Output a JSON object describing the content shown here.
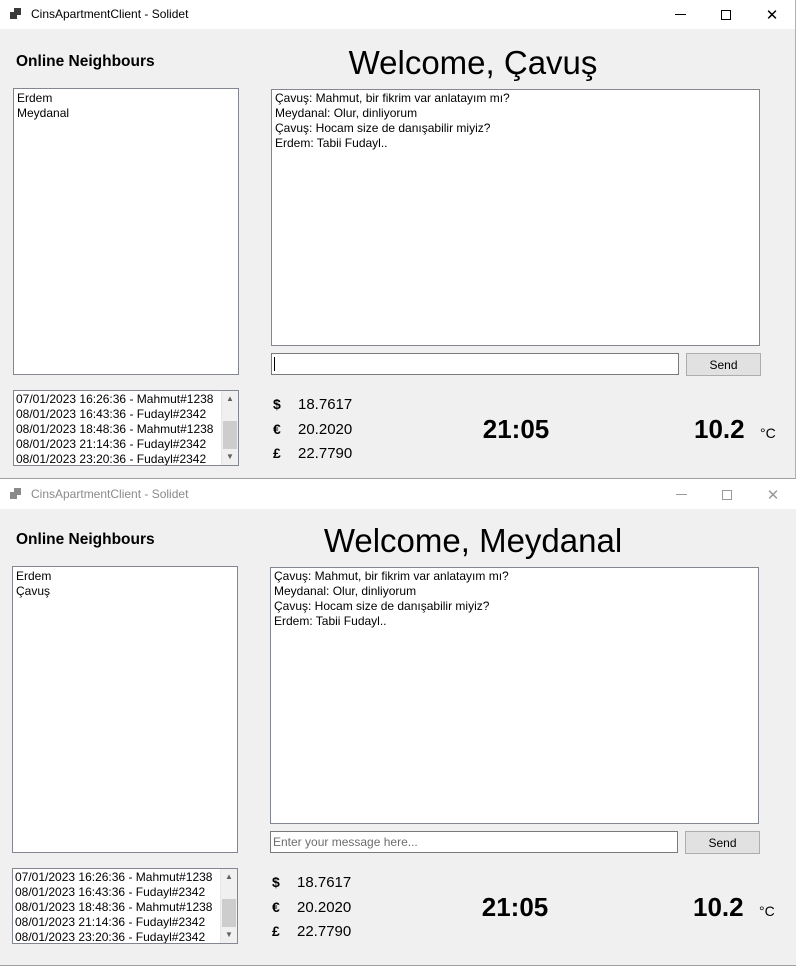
{
  "windows": [
    {
      "title": "CinsApartmentClient - Solidet",
      "active": true,
      "online_heading": "Online Neighbours",
      "welcome": "Welcome, Çavuş",
      "neighbours": [
        "Erdem",
        "Meydanal"
      ],
      "chat_messages": [
        "Çavuş: Mahmut, bir fikrim var anlatayım mı?",
        "Meydanal: Olur, dinliyorum",
        "Çavuş: Hocam size de danışabilir miyiz?",
        "Erdem: Tabii Fudayl.."
      ],
      "message_input": {
        "value": "",
        "placeholder": ""
      },
      "send_label": "Send",
      "log_entries": [
        "07/01/2023 16:26:36 - Mahmut#1238",
        "08/01/2023 16:43:36 - Fudayl#2342",
        "08/01/2023 18:48:36 - Mahmut#1238",
        "08/01/2023 21:14:36 - Fudayl#2342",
        "08/01/2023 23:20:36 - Fudayl#2342"
      ],
      "currencies": [
        {
          "symbol": "$",
          "value": "18.7617"
        },
        {
          "symbol": "€",
          "value": "20.2020"
        },
        {
          "symbol": "£",
          "value": "22.7790"
        }
      ],
      "clock": "21:05",
      "temperature": "10.2",
      "temperature_unit": "°C"
    },
    {
      "title": "CinsApartmentClient - Solidet",
      "active": false,
      "online_heading": "Online Neighbours",
      "welcome": "Welcome, Meydanal",
      "neighbours": [
        "Erdem",
        "Çavuş"
      ],
      "chat_messages": [
        "Çavuş: Mahmut, bir fikrim var anlatayım mı?",
        "Meydanal: Olur, dinliyorum",
        "Çavuş: Hocam size de danışabilir miyiz?",
        "Erdem: Tabii Fudayl.."
      ],
      "message_input": {
        "value": "",
        "placeholder": "Enter your message here..."
      },
      "send_label": "Send",
      "log_entries": [
        "07/01/2023 16:26:36 - Mahmut#1238",
        "08/01/2023 16:43:36 - Fudayl#2342",
        "08/01/2023 18:48:36 - Mahmut#1238",
        "08/01/2023 21:14:36 - Fudayl#2342",
        "08/01/2023 23:20:36 - Fudayl#2342"
      ],
      "currencies": [
        {
          "symbol": "$",
          "value": "18.7617"
        },
        {
          "symbol": "€",
          "value": "20.2020"
        },
        {
          "symbol": "£",
          "value": "22.7790"
        }
      ],
      "clock": "21:05",
      "temperature": "10.2",
      "temperature_unit": "°C"
    }
  ]
}
